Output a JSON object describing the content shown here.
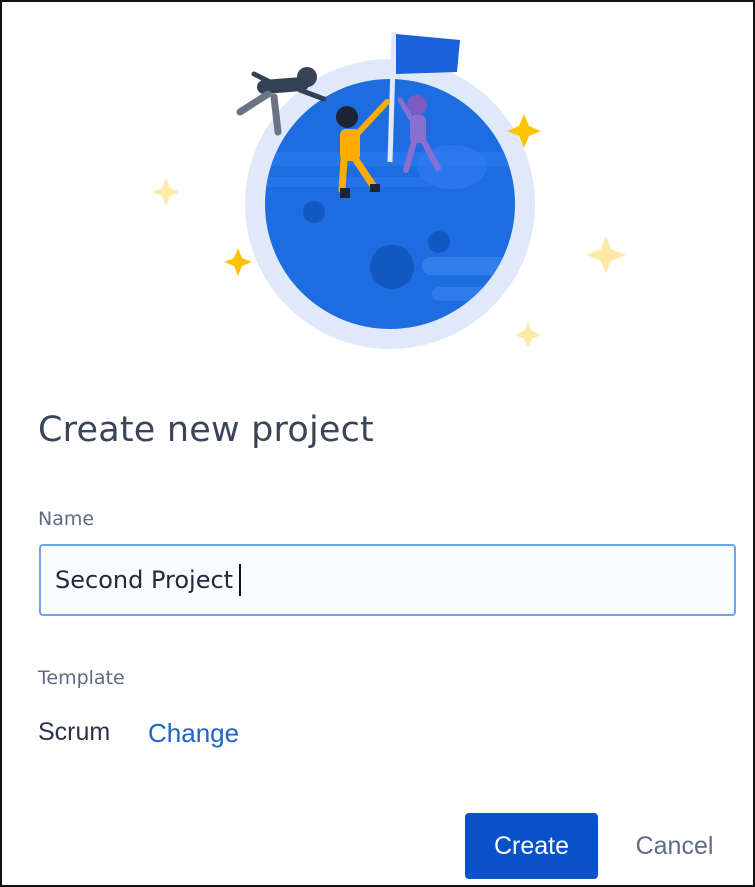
{
  "dialog": {
    "title": "Create new project",
    "name_label": "Name",
    "name_value": "Second Project",
    "template_label": "Template",
    "template_value": "Scrum",
    "change_link": "Change",
    "create_button": "Create",
    "cancel_button": "Cancel"
  },
  "colors": {
    "primary": "#0851c9",
    "link": "#1f63c6",
    "field_border_focus": "#6aa6ee",
    "title_text": "#3b4559",
    "label_text": "#5e6c84",
    "planet": "#1d6de0",
    "planet_halo": "#dfe9fa",
    "star": "#ffc400"
  },
  "illustration": {
    "icon": "planet-flag-illustration"
  }
}
